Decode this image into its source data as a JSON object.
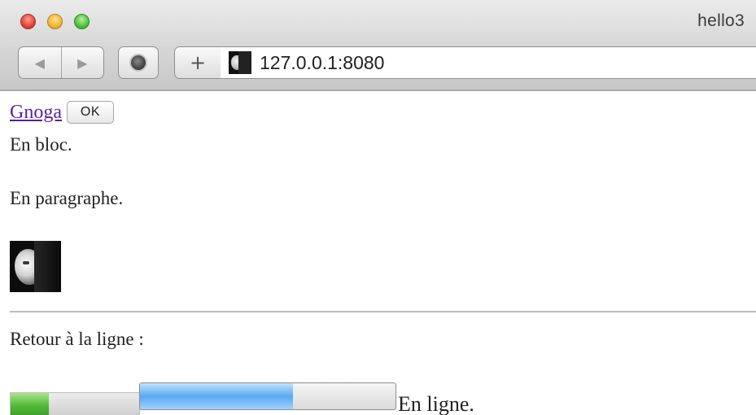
{
  "browser": {
    "window_title": "hello3",
    "back_glyph": "◀",
    "forward_glyph": "▶",
    "add_glyph": "+",
    "url": "127.0.0.1:8080",
    "icons": {
      "close": "close-traffic-light-icon",
      "minimize": "minimize-traffic-light-icon",
      "zoom": "zoom-traffic-light-icon",
      "stop": "stop-icon",
      "favicon": "site-favicon-icon"
    }
  },
  "page": {
    "link_text": "Gnoga",
    "ok_button_label": "OK",
    "bloc_text": "En bloc.",
    "paragraph_text": "En paragraphe.",
    "retour_text": "Retour à la ligne :",
    "inline_text": "En ligne.",
    "meter_value": 0.3,
    "progress_value": 0.6,
    "colors": {
      "link": "#5b1ea8",
      "meter_fill": "#52b93a",
      "progress_fill": "#5aa9f0"
    }
  }
}
